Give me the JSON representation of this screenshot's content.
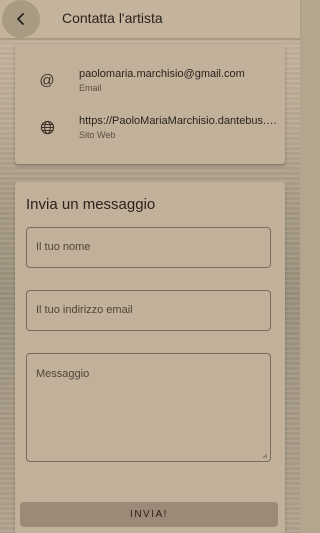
{
  "header": {
    "title": "Contatta l'artista"
  },
  "contacts": [
    {
      "icon": "at-icon",
      "value": "paolomaria.marchisio@gmail.com",
      "label": "Email"
    },
    {
      "icon": "globe-icon",
      "value": "https://PaoloMariaMarchisio.dantebus.com",
      "label": "Sito Web"
    }
  ],
  "form": {
    "title": "Invia un messaggio",
    "name_placeholder": "Il tuo nome",
    "email_placeholder": "Il tuo indirizzo email",
    "message_placeholder": "Messaggio",
    "submit_label": "INVIA!"
  },
  "colors": {
    "accent": "#9c8978",
    "card": "#c1b19b"
  }
}
